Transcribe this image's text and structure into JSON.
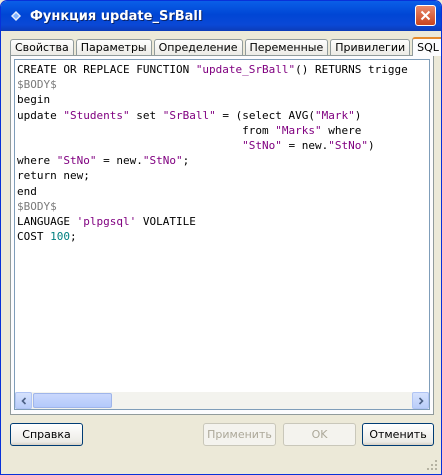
{
  "window": {
    "title": "Функция update_SrBall"
  },
  "tabs": [
    {
      "label": "Свойства"
    },
    {
      "label": "Параметры"
    },
    {
      "label": "Определение"
    },
    {
      "label": "Переменные"
    },
    {
      "label": "Привилегии"
    },
    {
      "label": "SQL"
    }
  ],
  "active_tab": "SQL",
  "sql_lines": [
    "CREATE OR REPLACE FUNCTION \"update_SrBall\"() RETURNS trigge",
    "$BODY$",
    "begin",
    "update \"Students\" set \"SrBall\" = (select AVG(\"Mark\")",
    "                                  from \"Marks\" where",
    "                                  \"StNo\" = new.\"StNo\")",
    "where \"StNo\" = new.\"StNo\";",
    "return new;",
    "end",
    "$BODY$",
    "LANGUAGE 'plpgsql' VOLATILE",
    "COST 100;"
  ],
  "buttons": {
    "help": "Справка",
    "apply": "Применить",
    "ok": "OK",
    "cancel": "Отменить"
  },
  "colors": {
    "title_bar": "#0054e3",
    "string": "#800080",
    "number": "#008080",
    "tab_accent": "#e68b2c"
  }
}
